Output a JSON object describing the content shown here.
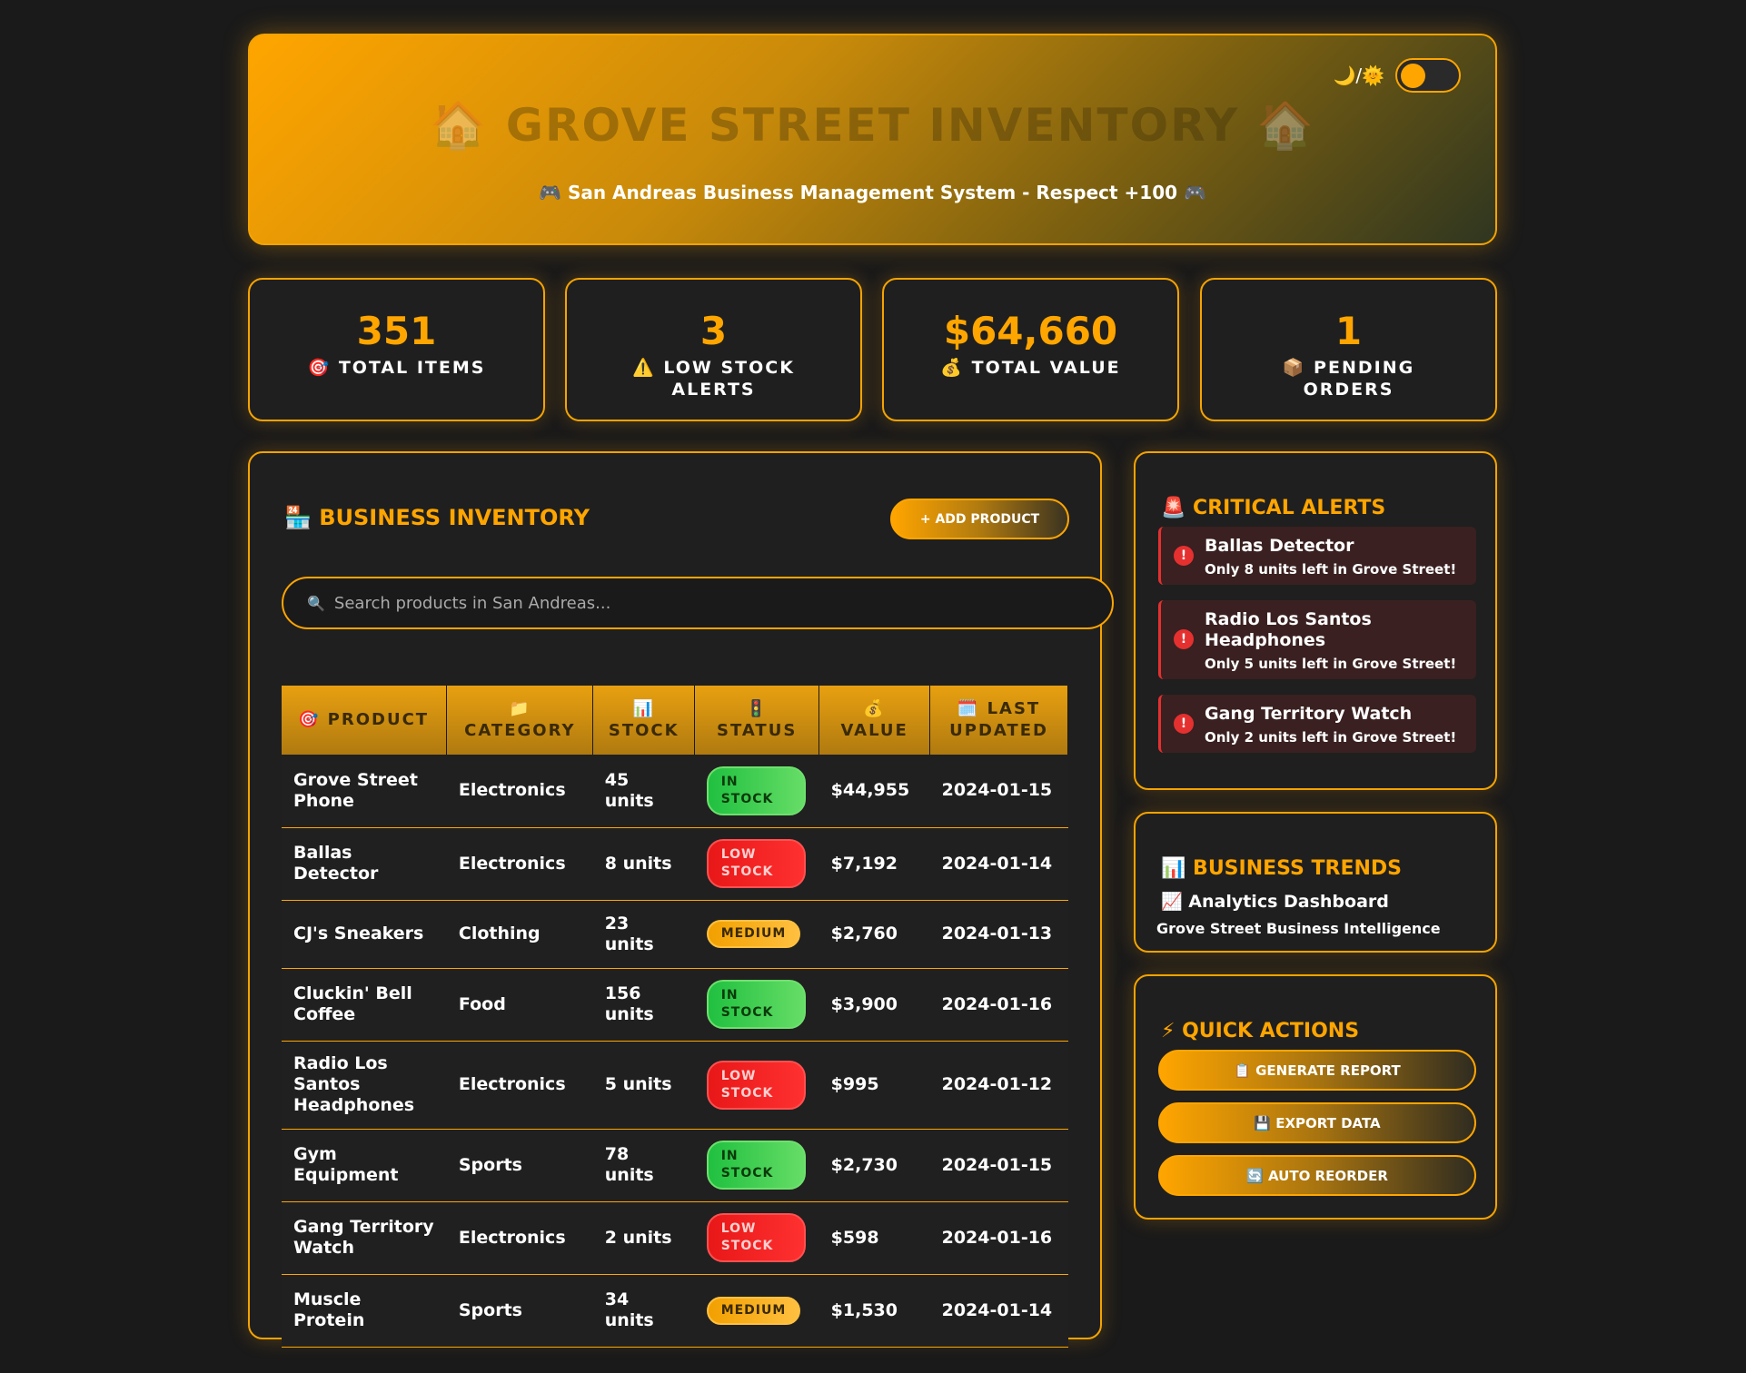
{
  "header": {
    "title": "🏠 Grove Street Inventory 🏠",
    "subtitle": "🎮 San Andreas Business Management System - Respect +100 🎮",
    "theme_icon": "🌙/🌞"
  },
  "stats": [
    {
      "value": "351",
      "label": "🎯 Total Items"
    },
    {
      "value": "3",
      "label": "⚠️ Low Stock Alerts"
    },
    {
      "value": "$64,660",
      "label": "💰 Total Value"
    },
    {
      "value": "1",
      "label": "📦 Pending Orders"
    }
  ],
  "inventory": {
    "title": "🏪 Business Inventory",
    "add_button": "+ Add Product",
    "search_icon": "🔍",
    "search_placeholder": "Search products in San Andreas...",
    "columns": [
      "🎯 Product",
      "📁 Category",
      "📊 Stock",
      "🚦 Status",
      "💰 Value",
      "🗓️ Last Updated"
    ],
    "rows": [
      {
        "product": "Grove Street Phone",
        "category": "Electronics",
        "stock": "45 units",
        "status": "In Stock",
        "value": "$44,955",
        "updated": "2024-01-15"
      },
      {
        "product": "Ballas Detector",
        "category": "Electronics",
        "stock": "8 units",
        "status": "Low Stock",
        "value": "$7,192",
        "updated": "2024-01-14"
      },
      {
        "product": "CJ's Sneakers",
        "category": "Clothing",
        "stock": "23 units",
        "status": "Medium",
        "value": "$2,760",
        "updated": "2024-01-13"
      },
      {
        "product": "Cluckin' Bell Coffee",
        "category": "Food",
        "stock": "156 units",
        "status": "In Stock",
        "value": "$3,900",
        "updated": "2024-01-16"
      },
      {
        "product": "Radio Los Santos Headphones",
        "category": "Electronics",
        "stock": "5 units",
        "status": "Low Stock",
        "value": "$995",
        "updated": "2024-01-12"
      },
      {
        "product": "Gym Equipment",
        "category": "Sports",
        "stock": "78 units",
        "status": "In Stock",
        "value": "$2,730",
        "updated": "2024-01-15"
      },
      {
        "product": "Gang Territory Watch",
        "category": "Electronics",
        "stock": "2 units",
        "status": "Low Stock",
        "value": "$598",
        "updated": "2024-01-16"
      },
      {
        "product": "Muscle Protein",
        "category": "Sports",
        "stock": "34 units",
        "status": "Medium",
        "value": "$1,530",
        "updated": "2024-01-14"
      }
    ]
  },
  "alerts": {
    "title": "🚨 Critical Alerts",
    "items": [
      {
        "name": "Ballas Detector",
        "message": "Only 8 units left in Grove Street!"
      },
      {
        "name": "Radio Los Santos Headphones",
        "message": "Only 5 units left in Grove Street!"
      },
      {
        "name": "Gang Territory Watch",
        "message": "Only 2 units left in Grove Street!"
      }
    ]
  },
  "trends": {
    "title": "📊 Business Trends",
    "heading": "📈 Analytics Dashboard",
    "subheading": "Grove Street Business Intelligence"
  },
  "actions": {
    "title": "⚡ Quick Actions",
    "buttons": [
      "📋 Generate Report",
      "💾 Export Data",
      "🔄 Auto Reorder"
    ]
  }
}
